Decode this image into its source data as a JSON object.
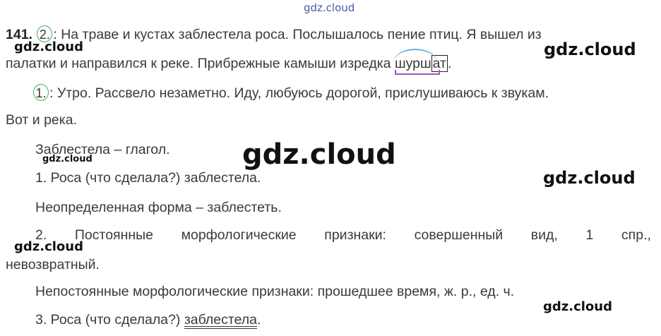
{
  "watermarks": {
    "top": "gdz.cloud",
    "wm1": "gdz.cloud",
    "wm2": "gdz.cloud",
    "wm3": "gdz.cloud",
    "wm4": "gdz.cloud",
    "wm5": "gdz.cloud",
    "wm6": "gdz.cloud",
    "wm7": "gdz.cloud"
  },
  "task": {
    "number": "141.",
    "s2_num": "2.",
    "s2_text_a": ": На траве и кустах заблестела роса. Послышалось пение птиц. Я вышел из",
    "s2_text_b_pre": "палатки и направился к реке. Прибрежные камыши изредка ",
    "s2_word_root": "шурш",
    "s2_word_ending": "ат",
    "s2_text_b_post": ".",
    "s1_num": "1.",
    "s1_text_a": ": Утро. Рассвело незаметно. Иду, любуюсь дорогой, прислушиваюсь к звукам.",
    "s1_text_b": "Вот и река."
  },
  "analysis": {
    "heading": "Заблестела – глагол.",
    "p1": "1. Роса (что сделала?) заблестела.",
    "infinitive": "Неопределенная форма – заблестеть.",
    "p2_words": [
      "2.",
      "Постоянные",
      "морфологические",
      "признаки:",
      "совершенный",
      "вид,",
      "1",
      "спр.,"
    ],
    "p2_cont": "невозвратный.",
    "non_constant": "Непостоянные морфологические признаки: прошедшее время, ж. р., ед. ч.",
    "p3_pre": "3. Роса (что сделала?) ",
    "p3_word": "заблестела",
    "p3_post": "."
  }
}
